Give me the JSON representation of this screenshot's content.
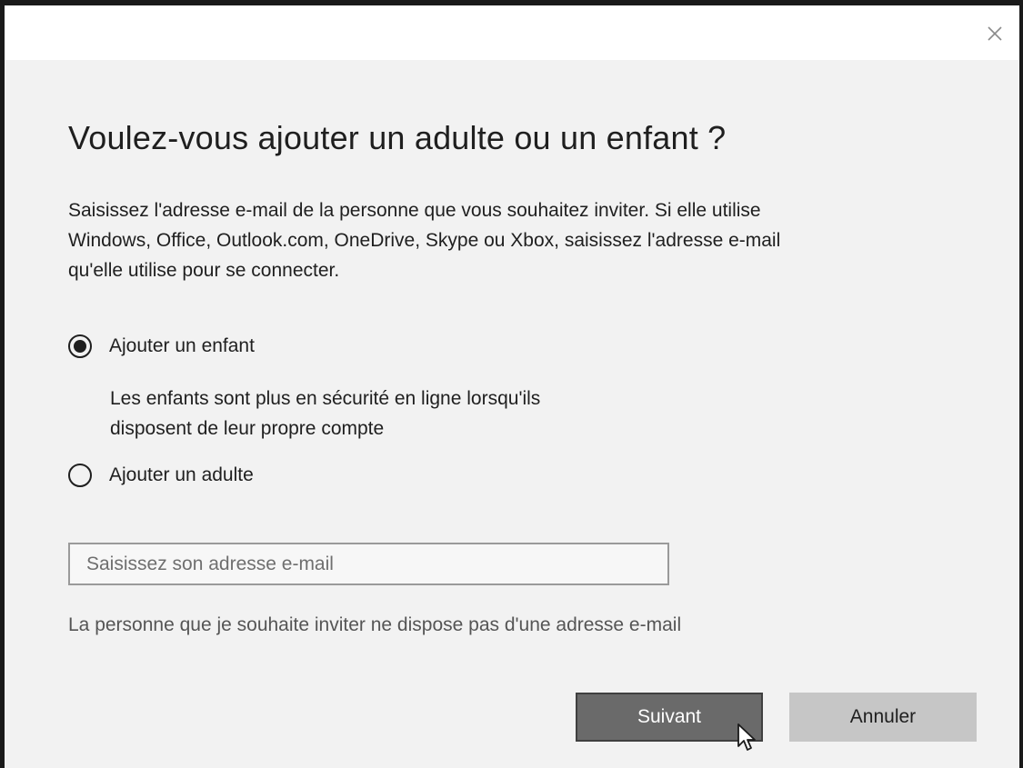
{
  "dialog": {
    "close_icon": "close-icon",
    "title": "Voulez-vous ajouter un adulte ou un enfant ?",
    "description_lines": [
      "Saisissez l'adresse e-mail de la personne que vous souhaitez inviter. Si elle utilise",
      "Windows, Office, Outlook.com, OneDrive, Skype ou Xbox, saisissez l'adresse e-mail",
      "qu'elle utilise pour se connecter."
    ],
    "options": [
      {
        "label": "Ajouter un enfant",
        "selected": true,
        "description_lines": [
          "Les enfants sont plus en sécurité en ligne lorsqu'ils",
          "disposent de leur propre compte"
        ]
      },
      {
        "label": "Ajouter un adulte",
        "selected": false
      }
    ],
    "email": {
      "value": "",
      "placeholder": "Saisissez son adresse e-mail"
    },
    "no_email_link": "La personne que je souhaite inviter ne dispose pas d'une adresse e-mail",
    "buttons": {
      "next": "Suivant",
      "cancel": "Annuler"
    }
  },
  "colors": {
    "background": "#f2f2f2",
    "titlebar": "#ffffff",
    "primary_button": "#6a6a6a",
    "secondary_button": "#c6c6c6",
    "text": "#1f1f1f",
    "link_text": "#555555"
  }
}
